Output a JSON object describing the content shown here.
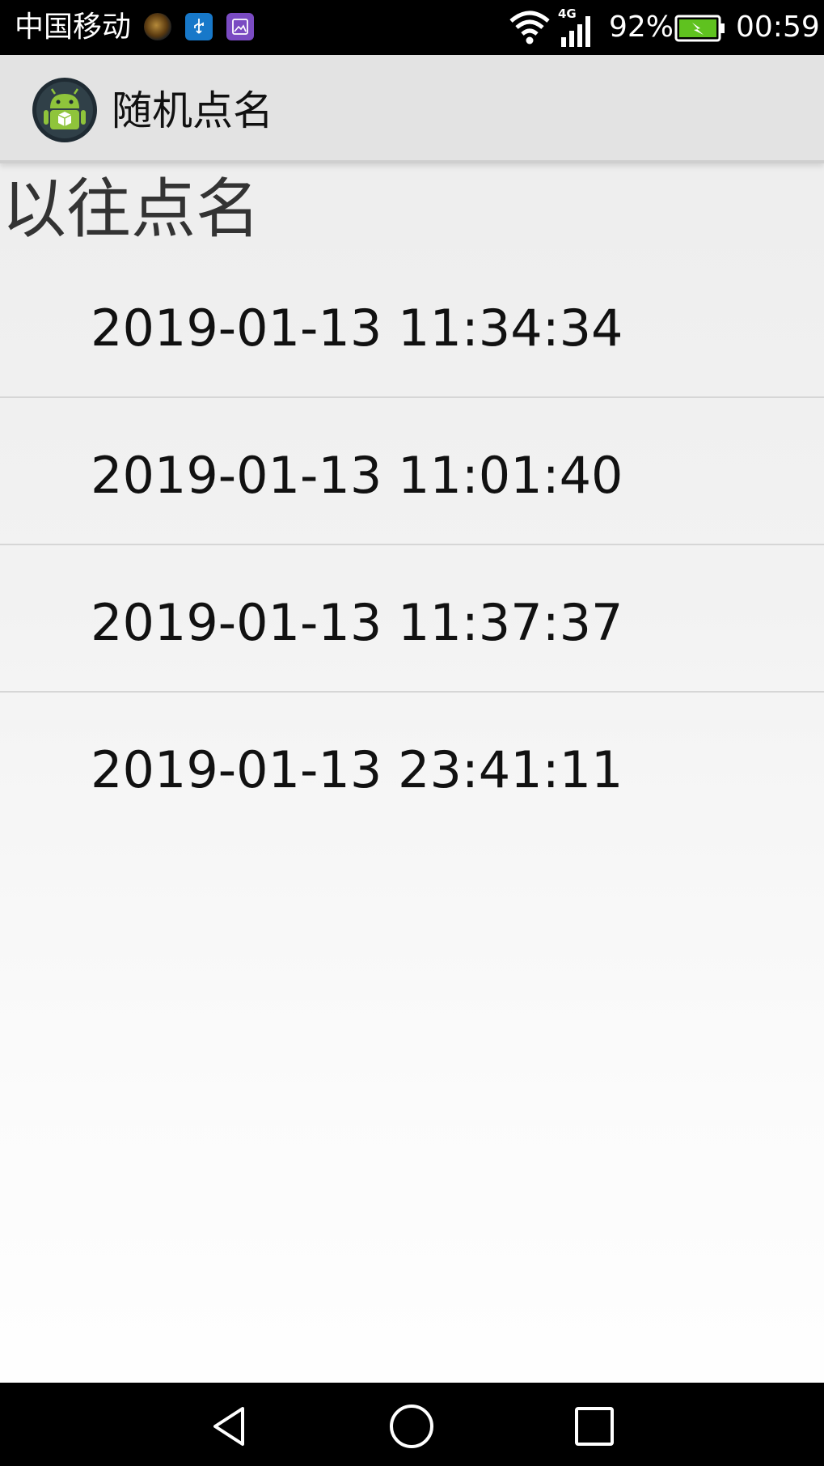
{
  "status_bar": {
    "carrier": "中国移动",
    "network_type": "4G",
    "battery_percent": "92%",
    "time": "00:59",
    "notification_icons": [
      "game-notification-icon",
      "usb-icon",
      "gallery-icon"
    ]
  },
  "action_bar": {
    "app_icon": "android-app-icon",
    "title": "随机点名"
  },
  "page": {
    "section_title": "以往点名"
  },
  "history": {
    "items": [
      {
        "timestamp": "2019-01-13 11:34:34"
      },
      {
        "timestamp": "2019-01-13 11:01:40"
      },
      {
        "timestamp": "2019-01-13 11:37:37"
      },
      {
        "timestamp": "2019-01-13 23:41:11"
      }
    ]
  },
  "nav_bar": {
    "buttons": [
      "back-icon",
      "home-icon",
      "recent-apps-icon"
    ]
  },
  "colors": {
    "status_bar_bg": "#000000",
    "action_bar_bg": "#e3e3e3",
    "battery_fill": "#5fc21f",
    "divider": "#d6d6d6"
  }
}
